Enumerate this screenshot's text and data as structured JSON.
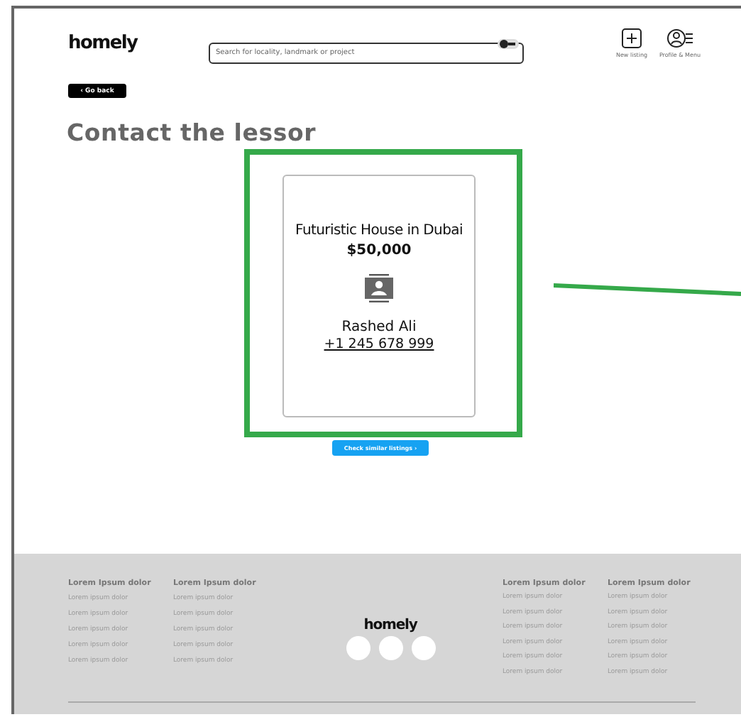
{
  "header": {
    "logo": "homely",
    "search": {
      "placeholder": "Search for locality, landmark or project"
    },
    "actions": [
      {
        "kind": "add",
        "label": "New listing"
      },
      {
        "kind": "profile",
        "label": "Profile & Menu"
      }
    ]
  },
  "back_button": "‹ Go back",
  "heading": "Contact the lessor",
  "card": {
    "title": "Futuristic House in Dubai",
    "price": "$50,000",
    "name": "Rashed Ali",
    "phone": "+1 245 678 999"
  },
  "similar_button": "Check similar listings ›",
  "footer": {
    "logo": "homely",
    "left_columns": [
      {
        "heading": "Lorem Ipsum dolor",
        "items": [
          "Lorem ipsum dolor",
          "Lorem ipsum dolor",
          "Lorem ipsum dolor",
          "Lorem ipsum dolor",
          "Lorem ipsum dolor"
        ]
      },
      {
        "heading": "Lorem Ipsum dolor",
        "items": [
          "Lorem ipsum dolor",
          "Lorem ipsum dolor",
          "Lorem ipsum dolor",
          "Lorem ipsum dolor",
          "Lorem ipsum dolor"
        ]
      }
    ],
    "right_columns": [
      {
        "heading": "Lorem Ipsum dolor",
        "items": [
          "Lorem ipsum dolor",
          "Lorem ipsum dolor",
          "Lorem ipsum dolor",
          "Lorem ipsum dolor",
          "Lorem ipsum dolor",
          "Lorem ipsum dolor"
        ]
      },
      {
        "heading": "Lorem Ipsum dolor",
        "items": [
          "Lorem ipsum dolor",
          "Lorem ipsum dolor",
          "Lorem ipsum dolor",
          "Lorem ipsum dolor",
          "Lorem ipsum dolor",
          "Lorem ipsum dolor"
        ]
      }
    ]
  }
}
